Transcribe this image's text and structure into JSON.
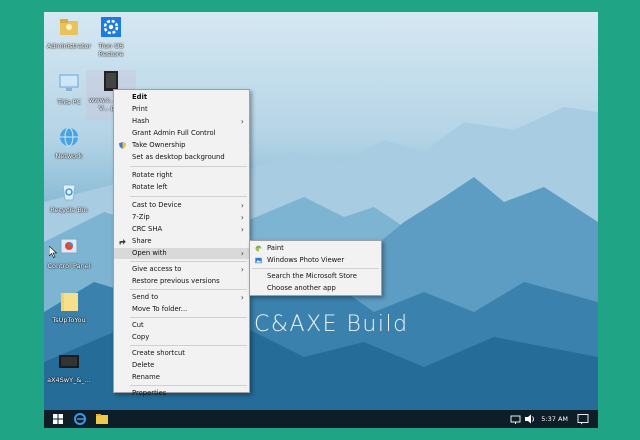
{
  "desktop": {
    "icons": [
      {
        "label": "Administrator"
      },
      {
        "label": "Tron OS Restore"
      },
      {
        "label": "This PC"
      },
      {
        "label": "www.c... HMI-V... pr..."
      },
      {
        "label": "Network"
      },
      {
        "label": "Recycle Bin"
      },
      {
        "label": "Control Panel"
      },
      {
        "label": "TsUpToYou"
      },
      {
        "label": "aX4SwY_&_..."
      }
    ],
    "watermark": "C&AXE Build"
  },
  "context_menu": {
    "items": [
      {
        "label": "Edit",
        "bold": true
      },
      {
        "label": "Print"
      },
      {
        "label": "Hash",
        "submenu": true
      },
      {
        "label": "Grant Admin Full Control"
      },
      {
        "label": "Take Ownership",
        "icon": "shield-icon"
      },
      {
        "label": "Set as desktop background"
      },
      {
        "label": "Rotate right"
      },
      {
        "label": "Rotate left"
      },
      {
        "label": "Cast to Device",
        "submenu": true
      },
      {
        "label": "7-Zip",
        "submenu": true
      },
      {
        "label": "CRC SHA",
        "submenu": true
      },
      {
        "label": "Share",
        "icon": "share-icon"
      },
      {
        "label": "Open with",
        "submenu": true,
        "highlighted": true
      },
      {
        "label": "Give access to",
        "submenu": true
      },
      {
        "label": "Restore previous versions"
      },
      {
        "label": "Send to",
        "submenu": true
      },
      {
        "label": "Move To folder..."
      },
      {
        "label": "Cut"
      },
      {
        "label": "Copy"
      },
      {
        "label": "Create shortcut"
      },
      {
        "label": "Delete"
      },
      {
        "label": "Rename"
      },
      {
        "label": "Properties"
      }
    ]
  },
  "open_with_submenu": {
    "items": [
      {
        "label": "Paint",
        "icon": "paint-icon"
      },
      {
        "label": "Windows Photo Viewer",
        "icon": "photo-viewer-icon"
      },
      {
        "label": "Search the Microsoft Store"
      },
      {
        "label": "Choose another app"
      }
    ]
  },
  "taskbar": {
    "clock": "5:37 AM"
  },
  "colors": {
    "outer_border": "#1fa585",
    "taskbar": "#0e1e28",
    "menu_bg": "#f2f2f2",
    "menu_highlight": "#d9d9d9"
  }
}
